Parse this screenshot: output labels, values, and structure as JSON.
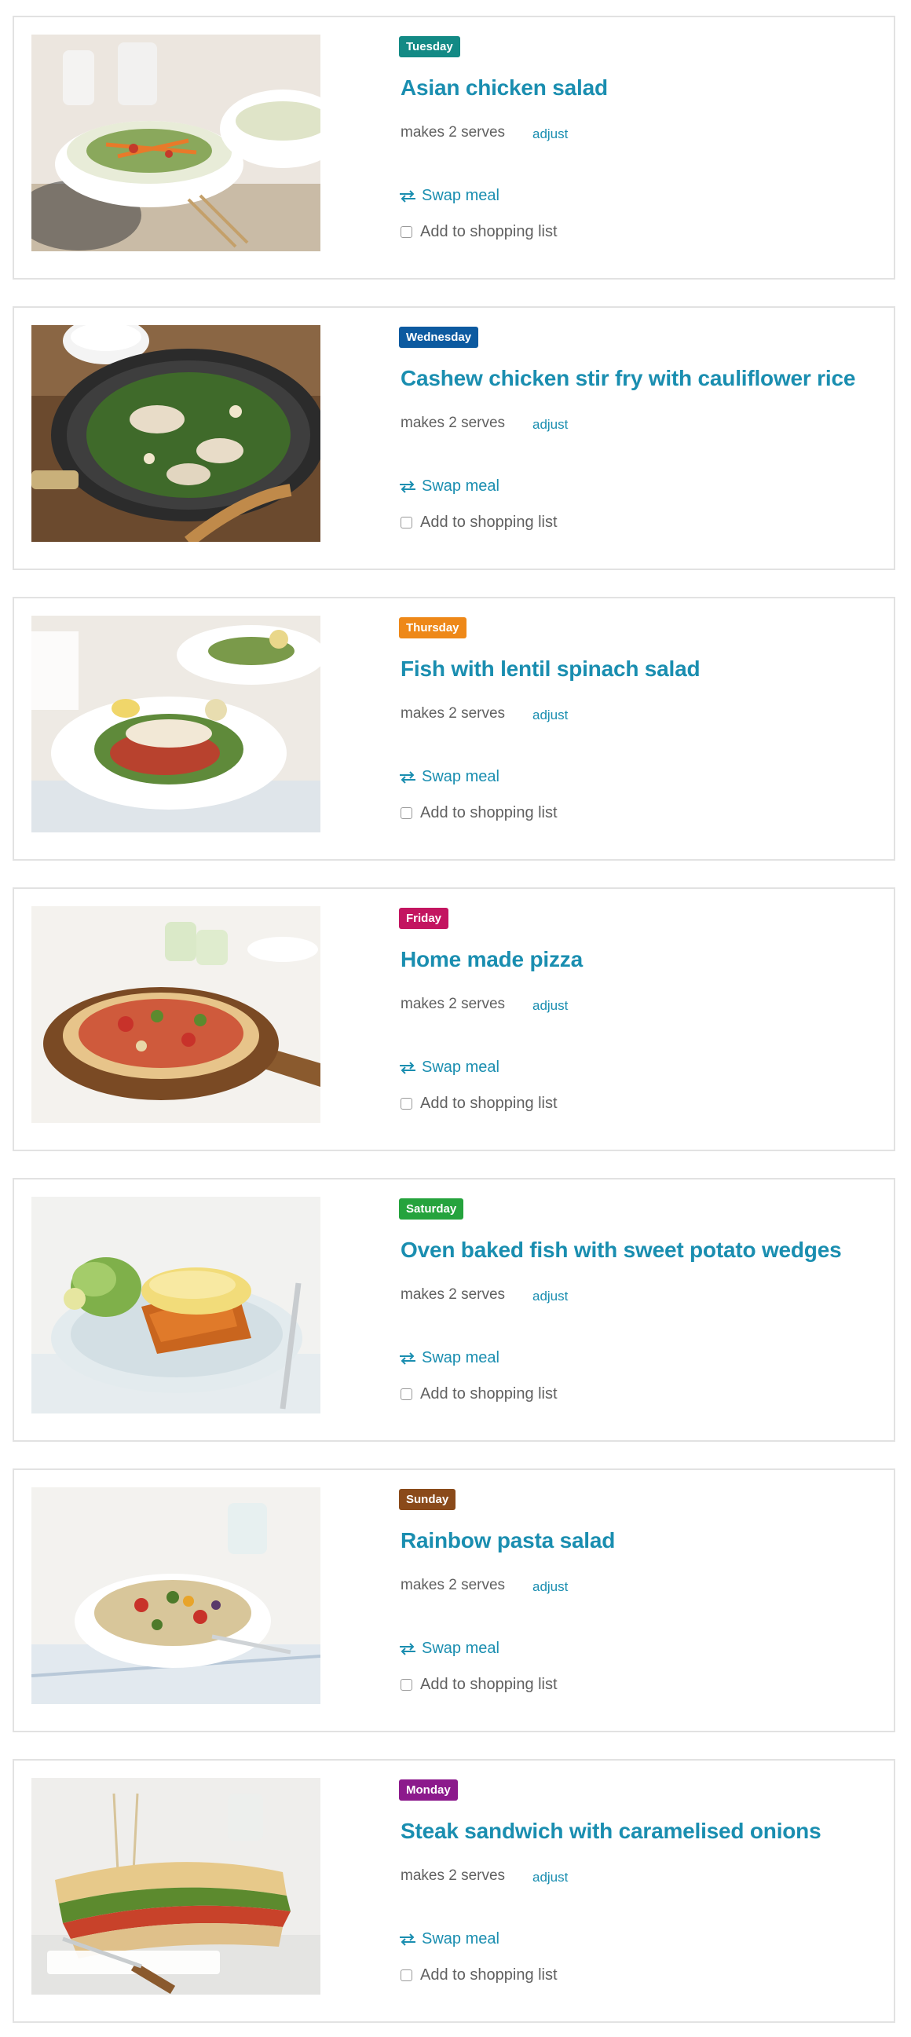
{
  "meals": [
    {
      "day": "Tuesday",
      "day_color": "#138a85",
      "title": "Asian chicken salad",
      "serves": "makes 2 serves",
      "adjust": "adjust",
      "swap": "Swap meal",
      "shopping": "Add to shopping list",
      "photo_icon": "asian-chicken-salad-photo"
    },
    {
      "day": "Wednesday",
      "day_color": "#0c5aa0",
      "title": "Cashew chicken stir fry with cauliflower rice",
      "serves": "makes 2 serves",
      "adjust": "adjust",
      "swap": "Swap meal",
      "shopping": "Add to shopping list",
      "photo_icon": "cashew-chicken-stir-fry-photo"
    },
    {
      "day": "Thursday",
      "day_color": "#ee8818",
      "title": "Fish with lentil spinach salad",
      "serves": "makes 2 serves",
      "adjust": "adjust",
      "swap": "Swap meal",
      "shopping": "Add to shopping list",
      "photo_icon": "fish-lentil-salad-photo"
    },
    {
      "day": "Friday",
      "day_color": "#c31560",
      "title": "Home made pizza",
      "serves": "makes 2 serves",
      "adjust": "adjust",
      "swap": "Swap meal",
      "shopping": "Add to shopping list",
      "photo_icon": "home-made-pizza-photo"
    },
    {
      "day": "Saturday",
      "day_color": "#25a33d",
      "title": "Oven baked fish with sweet potato wedges",
      "serves": "makes 2 serves",
      "adjust": "adjust",
      "swap": "Swap meal",
      "shopping": "Add to shopping list",
      "photo_icon": "oven-baked-fish-photo"
    },
    {
      "day": "Sunday",
      "day_color": "#8a4a1a",
      "title": "Rainbow pasta salad",
      "serves": "makes 2 serves",
      "adjust": "adjust",
      "swap": "Swap meal",
      "shopping": "Add to shopping list",
      "photo_icon": "rainbow-pasta-salad-photo"
    },
    {
      "day": "Monday",
      "day_color": "#8c1a8c",
      "title": "Steak sandwich with caramelised onions",
      "serves": "makes 2 serves",
      "adjust": "adjust",
      "swap": "Swap meal",
      "shopping": "Add to shopping list",
      "photo_icon": "steak-sandwich-photo"
    }
  ],
  "colors": {
    "accent": "#1a8eb0",
    "card_border": "#e2e2e2"
  }
}
